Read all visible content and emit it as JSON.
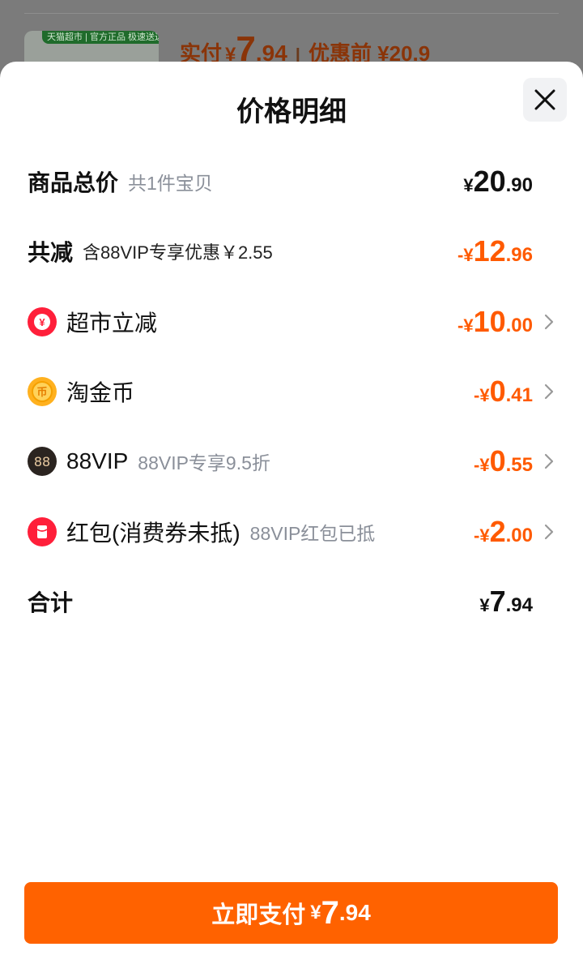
{
  "background": {
    "badge_text": "天猫超市 | 官方正品 极速送达",
    "price_label": "实付",
    "price_currency": "¥",
    "price_int": "7",
    "price_dec": ".94",
    "separator": "|",
    "original_label": "优惠前 ¥20.9"
  },
  "sheet": {
    "title": "价格明细",
    "close_icon": "close-icon"
  },
  "rows": {
    "total_goods": {
      "label": "商品总价",
      "sub": "共1件宝贝",
      "currency": "¥",
      "int": "20",
      "dec": ".90"
    },
    "total_discount": {
      "label": "共减",
      "sub": "含88VIP专享优惠￥2.55",
      "currency": "-¥",
      "int": "12",
      "dec": ".96"
    },
    "supermarket": {
      "label": "超市立减",
      "icon": "yen-coupon-icon",
      "currency": "-¥",
      "int": "10",
      "dec": ".00"
    },
    "gold_coin": {
      "label": "淘金币",
      "icon": "gold-coin-icon",
      "currency": "-¥",
      "int": "0",
      "dec": ".41"
    },
    "vip88": {
      "label": "88VIP",
      "sub": "88VIP专享9.5折",
      "icon": "88vip-icon",
      "icon_text": "88",
      "currency": "-¥",
      "int": "0",
      "dec": ".55"
    },
    "red_packet": {
      "label": "红包(消费券未抵)",
      "sub": "88VIP红包已抵",
      "icon": "red-packet-icon",
      "currency": "-¥",
      "int": "2",
      "dec": ".00"
    },
    "sum": {
      "label": "合计",
      "currency": "¥",
      "int": "7",
      "dec": ".94"
    }
  },
  "pay_button": {
    "label": "立即支付",
    "currency": "¥",
    "int": "7",
    "dec": ".94"
  },
  "colors": {
    "accent": "#ff6200",
    "discount": "#ff5a00",
    "text": "#111111",
    "muted": "#8a8f99"
  }
}
